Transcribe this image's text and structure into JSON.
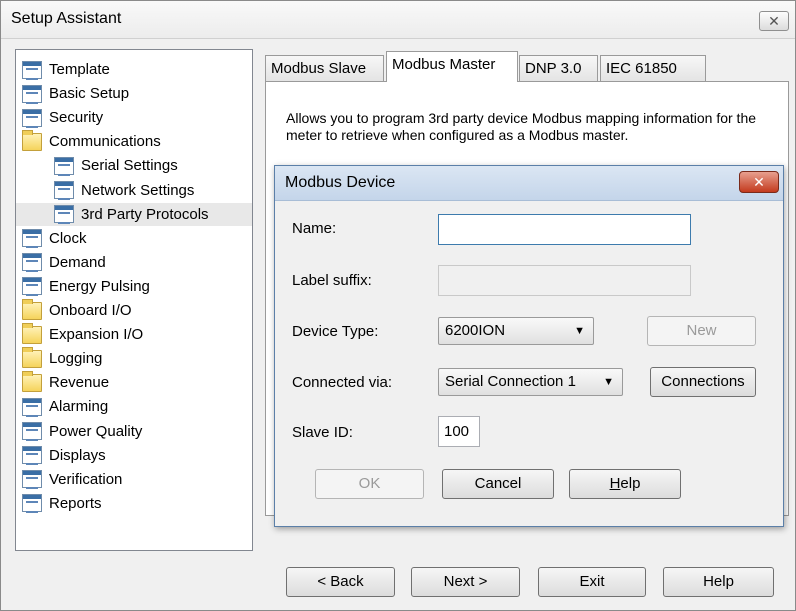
{
  "window": {
    "title": "Setup Assistant",
    "close_glyph": "✕"
  },
  "tree": [
    {
      "label": "Template",
      "icon": "doc-icon"
    },
    {
      "label": "Basic Setup",
      "icon": "doc-icon"
    },
    {
      "label": "Security",
      "icon": "doc-icon"
    },
    {
      "label": "Communications",
      "icon": "folder-icon"
    },
    {
      "label": "Serial Settings",
      "icon": "doc-icon"
    },
    {
      "label": "Network Settings",
      "icon": "doc-icon"
    },
    {
      "label": "3rd Party Protocols",
      "icon": "doc-icon",
      "selected": true
    },
    {
      "label": "Clock",
      "icon": "doc-icon"
    },
    {
      "label": "Demand",
      "icon": "doc-icon"
    },
    {
      "label": "Energy Pulsing",
      "icon": "doc-icon"
    },
    {
      "label": "Onboard I/O",
      "icon": "folder-icon"
    },
    {
      "label": "Expansion I/O",
      "icon": "folder-icon"
    },
    {
      "label": "Logging",
      "icon": "folder-icon"
    },
    {
      "label": "Revenue",
      "icon": "folder-icon"
    },
    {
      "label": "Alarming",
      "icon": "doc-icon"
    },
    {
      "label": "Power Quality",
      "icon": "doc-icon"
    },
    {
      "label": "Displays",
      "icon": "doc-icon"
    },
    {
      "label": "Verification",
      "icon": "doc-icon"
    },
    {
      "label": "Reports",
      "icon": "doc-icon"
    }
  ],
  "tabs": [
    "Modbus Slave",
    "Modbus Master",
    "DNP 3.0",
    "IEC 61850"
  ],
  "active_tab": "Modbus Master",
  "description": "Allows you to program 3rd party device Modbus mapping information for the meter to retrieve when configured as a Modbus master.",
  "dialog": {
    "title": "Modbus Device",
    "close_glyph": "✕",
    "name_label": "Name:",
    "name_value": "",
    "label_suffix_label": "Label suffix:",
    "label_suffix_value": "",
    "device_type_label": "Device Type:",
    "device_type_value": "6200ION",
    "new_button": "New",
    "connected_via_label": "Connected via:",
    "connected_via_value": "Serial Connection 1",
    "connections_button": "Connections",
    "slave_id_label": "Slave ID:",
    "slave_id_value": "100",
    "ok_button": "OK",
    "cancel_button": "Cancel",
    "help_button_pre": "",
    "help_button_mnemonic": "H",
    "help_button_post": "elp"
  },
  "footer": {
    "back_button": "< Back",
    "next_button": "Next >",
    "exit_button": "Exit",
    "help_button": "Help"
  },
  "caret_glyph": "▼"
}
